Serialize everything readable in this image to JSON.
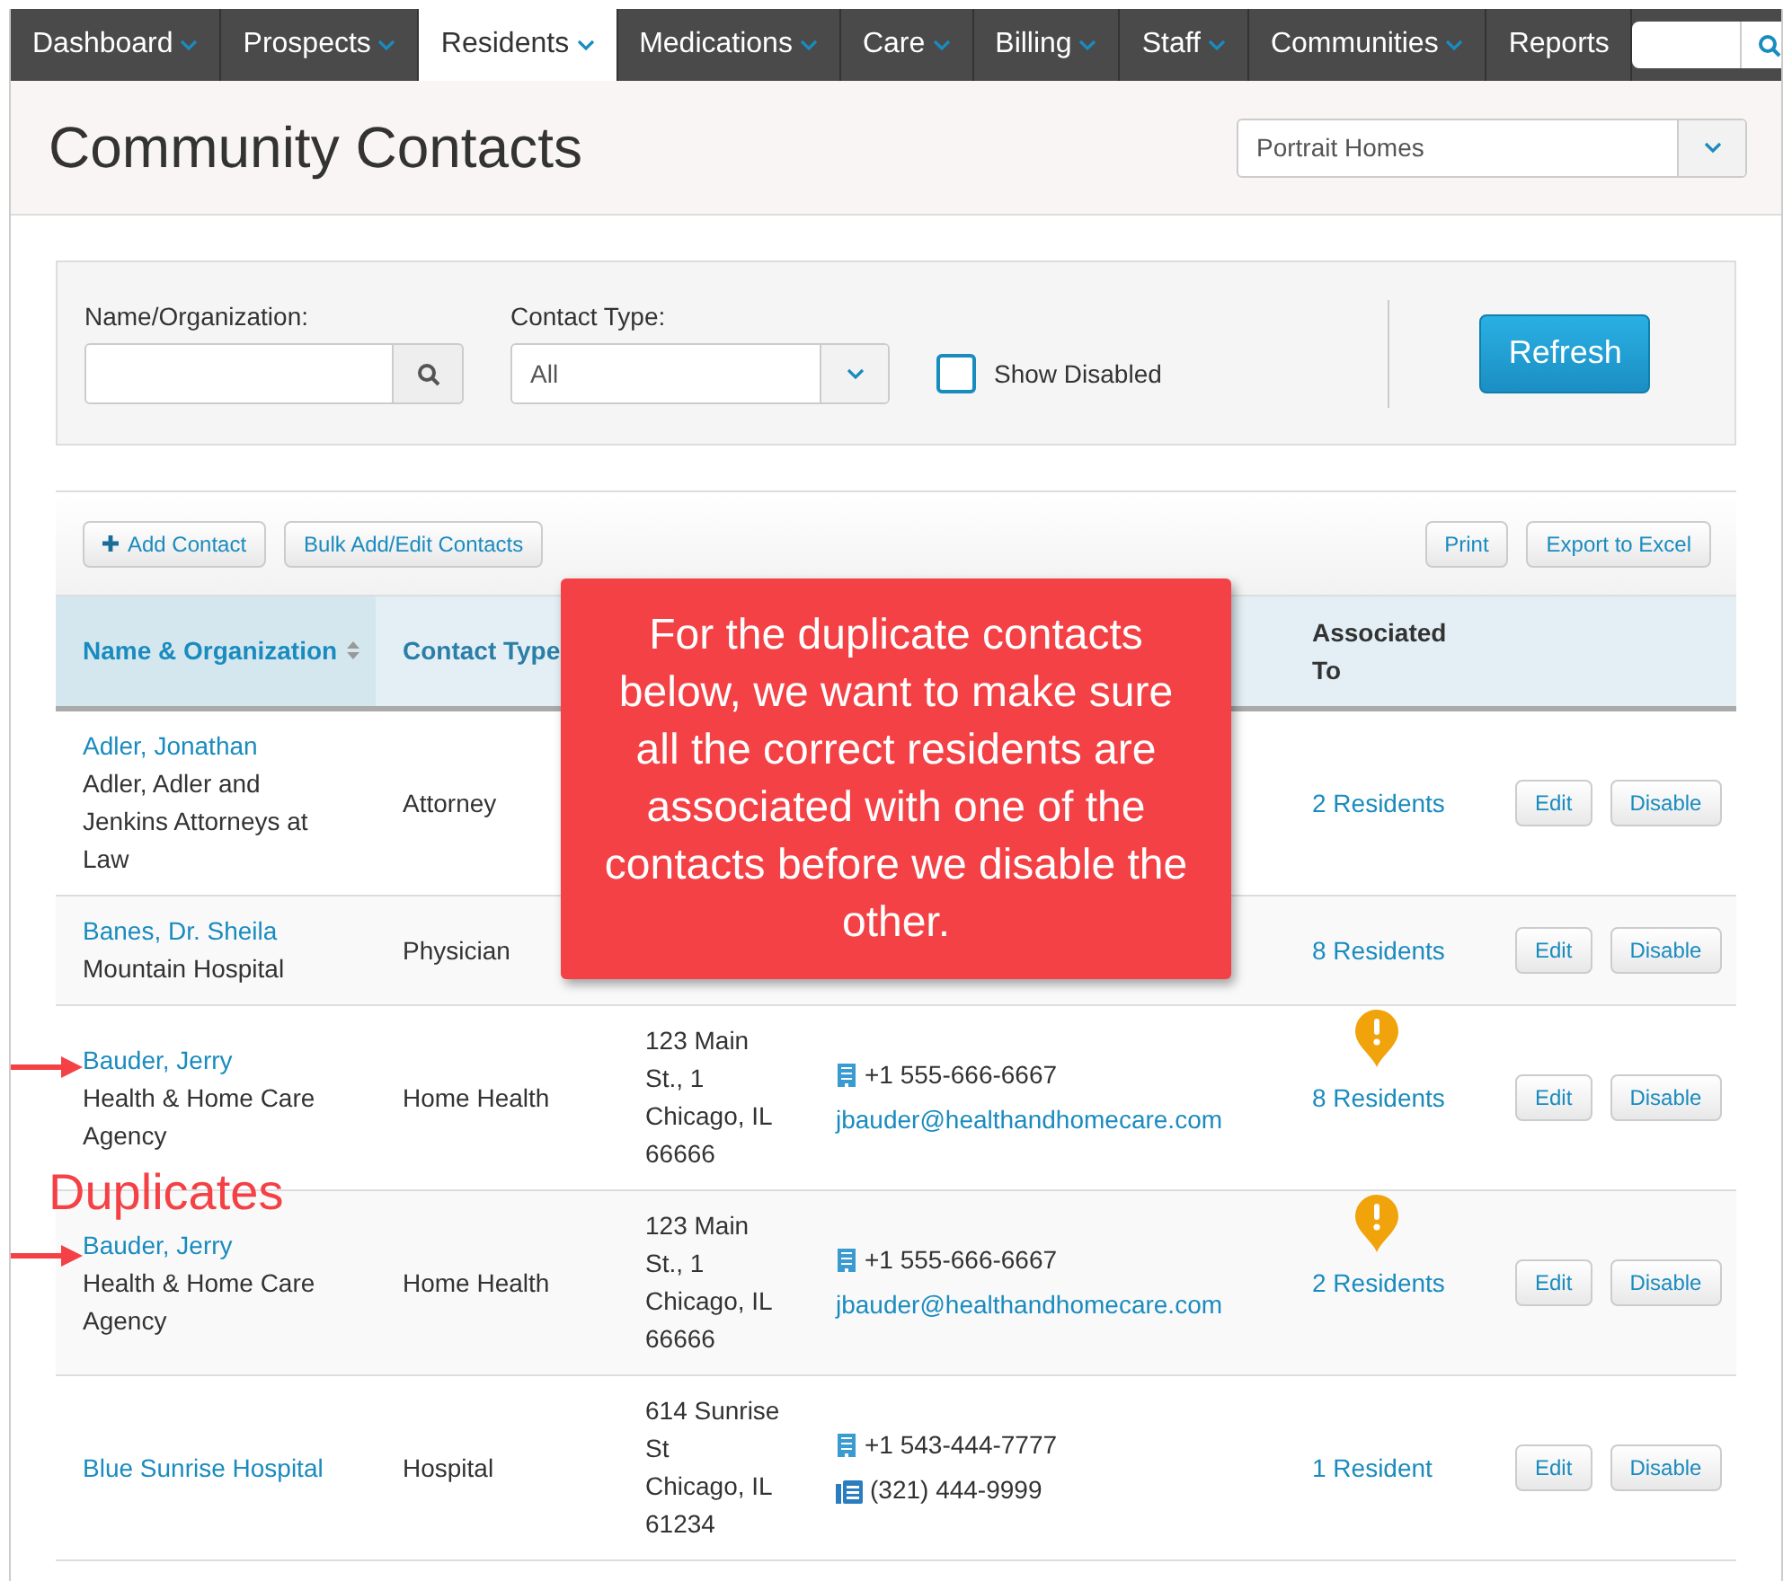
{
  "nav": [
    {
      "label": "Dashboard",
      "selected": false,
      "menu": true
    },
    {
      "label": "Prospects",
      "selected": false,
      "menu": true
    },
    {
      "label": "Residents",
      "selected": true,
      "menu": true
    },
    {
      "label": "Medications",
      "selected": false,
      "menu": true
    },
    {
      "label": "Care",
      "selected": false,
      "menu": true
    },
    {
      "label": "Billing",
      "selected": false,
      "menu": true
    },
    {
      "label": "Staff",
      "selected": false,
      "menu": true
    },
    {
      "label": "Communities",
      "selected": false,
      "menu": true
    },
    {
      "label": "Reports",
      "selected": false,
      "menu": false
    }
  ],
  "page_title": "Community Contacts",
  "community_select": {
    "value": "Portrait Homes"
  },
  "filters": {
    "name_label": "Name/Organization:",
    "type_label": "Contact Type:",
    "type_value": "All",
    "show_disabled": {
      "label": "Show Disabled",
      "checked": false
    },
    "refresh": "Refresh"
  },
  "toolbar": {
    "left": [
      {
        "label": "Add Contact",
        "kind": "add"
      },
      {
        "label": "Bulk Add/Edit Contacts",
        "kind": "plain"
      }
    ],
    "right": [
      {
        "label": "Print"
      },
      {
        "label": "Export to Excel"
      }
    ]
  },
  "columns": [
    {
      "label": "Name & Organization",
      "sorted": true
    },
    {
      "label": "Contact Type",
      "sorted": false
    },
    {},
    {},
    {
      "label": "Associated To",
      "sorted": false
    },
    {}
  ],
  "rows": [
    {
      "name": "Adler, Jonathan",
      "organization": "Adler, Adler and Jenkins Attorneys at Law",
      "type": "Attorney",
      "associated": "2 Residents",
      "warning": false,
      "flagged": false,
      "actions": [
        "Edit",
        "Disable"
      ]
    },
    {
      "name": "Banes, Dr. Sheila",
      "organization": "Mountain Hospital",
      "type": "Physician",
      "associated": "8 Residents",
      "warning": false,
      "flagged": false,
      "actions": [
        "Edit",
        "Disable"
      ]
    },
    {
      "name": "Bauder, Jerry",
      "organization": "Health & Home Care Agency",
      "type": "Home Health",
      "address": [
        "123 Main St., 1",
        "Chicago, IL 66666"
      ],
      "contacts": [
        {
          "kind": "phone",
          "text": "+1 555-666-6667"
        },
        {
          "kind": "email",
          "text": "jbauder@healthandhomecare.com"
        }
      ],
      "associated": "8 Residents",
      "warning": true,
      "flagged": true,
      "actions": [
        "Edit",
        "Disable"
      ]
    },
    {
      "name": "Bauder, Jerry",
      "organization": "Health & Home Care Agency",
      "type": "Home Health",
      "address": [
        "123 Main St., 1",
        "Chicago, IL 66666"
      ],
      "contacts": [
        {
          "kind": "phone",
          "text": "+1 555-666-6667"
        },
        {
          "kind": "email",
          "text": "jbauder@healthandhomecare.com"
        }
      ],
      "associated": "2 Residents",
      "warning": true,
      "flagged": true,
      "actions": [
        "Edit",
        "Disable"
      ]
    },
    {
      "name": "Blue Sunrise Hospital",
      "type": "Hospital",
      "address": [
        "614 Sunrise St",
        "Chicago, IL 61234"
      ],
      "contacts": [
        {
          "kind": "phone",
          "text": "+1 543-444-7777"
        },
        {
          "kind": "fax",
          "text": "(321) 444-9999"
        }
      ],
      "associated": "1 Resident",
      "warning": false,
      "flagged": false,
      "actions": [
        "Edit",
        "Disable"
      ]
    }
  ],
  "callout": "For the duplicate contacts below, we want to make sure all the correct residents are associated with one of the contacts before we disable the other.",
  "duplicates_label": "Duplicates"
}
